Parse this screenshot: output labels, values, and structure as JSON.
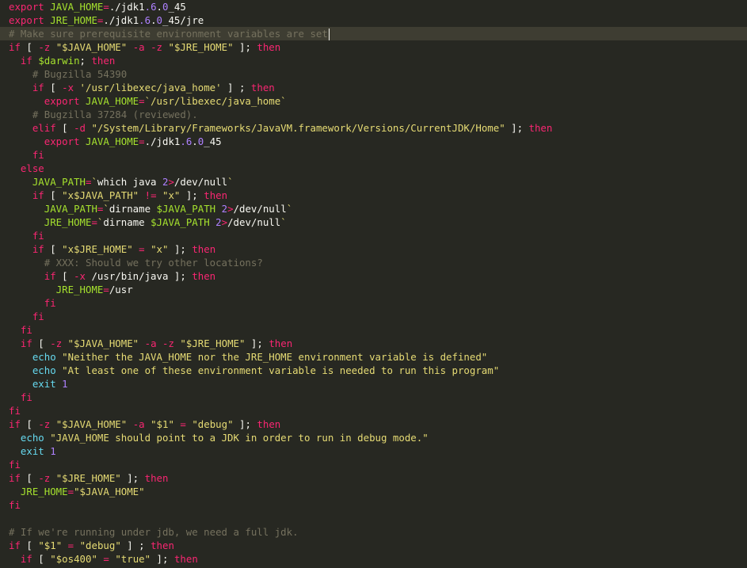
{
  "colors": {
    "background": "#272822",
    "current_line": "#3e3d32",
    "keyword": "#f92672",
    "builtin": "#66d9ef",
    "string": "#e6db74",
    "number": "#ae81ff",
    "variable": "#a6e22e",
    "comment": "#75715e",
    "text": "#f8f8f2"
  },
  "editor": {
    "current_line_index": 2,
    "lines": [
      [
        [
          "kw",
          "export"
        ],
        [
          "tx",
          " "
        ],
        [
          "var",
          "JAVA_HOME"
        ],
        [
          "kw",
          "="
        ],
        [
          "tx",
          "./jdk1"
        ],
        [
          "num",
          ".6"
        ],
        [
          "tx",
          "."
        ],
        [
          "num",
          "0"
        ],
        [
          "tx",
          "_45"
        ]
      ],
      [
        [
          "kw",
          "export"
        ],
        [
          "tx",
          " "
        ],
        [
          "var",
          "JRE_HOME"
        ],
        [
          "kw",
          "="
        ],
        [
          "tx",
          "./jdk1"
        ],
        [
          "num",
          ".6"
        ],
        [
          "tx",
          "."
        ],
        [
          "num",
          "0"
        ],
        [
          "tx",
          "_45/jre"
        ]
      ],
      [
        [
          "cm",
          "# Make sure prerequisite environment variables are set"
        ]
      ],
      [
        [
          "kw",
          "if"
        ],
        [
          "tx",
          " [ "
        ],
        [
          "kw",
          "-z"
        ],
        [
          "tx",
          " "
        ],
        [
          "str",
          "\"$JAVA_HOME\""
        ],
        [
          "tx",
          " "
        ],
        [
          "kw",
          "-a"
        ],
        [
          "tx",
          " "
        ],
        [
          "kw",
          "-z"
        ],
        [
          "tx",
          " "
        ],
        [
          "str",
          "\"$JRE_HOME\""
        ],
        [
          "tx",
          " ]; "
        ],
        [
          "kw",
          "then"
        ]
      ],
      [
        [
          "tx",
          "  "
        ],
        [
          "kw",
          "if"
        ],
        [
          "tx",
          " "
        ],
        [
          "var",
          "$darwin"
        ],
        [
          "tx",
          "; "
        ],
        [
          "kw",
          "then"
        ]
      ],
      [
        [
          "tx",
          "    "
        ],
        [
          "cm",
          "# Bugzilla 54390"
        ]
      ],
      [
        [
          "tx",
          "    "
        ],
        [
          "kw",
          "if"
        ],
        [
          "tx",
          " [ "
        ],
        [
          "kw",
          "-x"
        ],
        [
          "tx",
          " "
        ],
        [
          "str",
          "'/usr/libexec/java_home'"
        ],
        [
          "tx",
          " ] ; "
        ],
        [
          "kw",
          "then"
        ]
      ],
      [
        [
          "tx",
          "      "
        ],
        [
          "kw",
          "export"
        ],
        [
          "tx",
          " "
        ],
        [
          "var",
          "JAVA_HOME"
        ],
        [
          "kw",
          "="
        ],
        [
          "str",
          "`/usr/libexec/java_home`"
        ]
      ],
      [
        [
          "tx",
          "    "
        ],
        [
          "cm",
          "# Bugzilla 37284 (reviewed)."
        ]
      ],
      [
        [
          "tx",
          "    "
        ],
        [
          "kw",
          "elif"
        ],
        [
          "tx",
          " [ "
        ],
        [
          "kw",
          "-d"
        ],
        [
          "tx",
          " "
        ],
        [
          "str",
          "\"/System/Library/Frameworks/JavaVM.framework/Versions/CurrentJDK/Home\""
        ],
        [
          "tx",
          " ]; "
        ],
        [
          "kw",
          "then"
        ]
      ],
      [
        [
          "tx",
          "      "
        ],
        [
          "kw",
          "export"
        ],
        [
          "tx",
          " "
        ],
        [
          "var",
          "JAVA_HOME"
        ],
        [
          "kw",
          "="
        ],
        [
          "tx",
          "./jdk1"
        ],
        [
          "num",
          ".6"
        ],
        [
          "tx",
          "."
        ],
        [
          "num",
          "0"
        ],
        [
          "tx",
          "_45"
        ]
      ],
      [
        [
          "tx",
          "    "
        ],
        [
          "kw",
          "fi"
        ]
      ],
      [
        [
          "tx",
          "  "
        ],
        [
          "kw",
          "else"
        ]
      ],
      [
        [
          "tx",
          "    "
        ],
        [
          "var",
          "JAVA_PATH"
        ],
        [
          "kw",
          "="
        ],
        [
          "str",
          "`"
        ],
        [
          "tx",
          "which java "
        ],
        [
          "num",
          "2"
        ],
        [
          "kw",
          ">"
        ],
        [
          "tx",
          "/dev/null"
        ],
        [
          "str",
          "`"
        ]
      ],
      [
        [
          "tx",
          "    "
        ],
        [
          "kw",
          "if"
        ],
        [
          "tx",
          " [ "
        ],
        [
          "str",
          "\"x$JAVA_PATH\""
        ],
        [
          "tx",
          " "
        ],
        [
          "kw",
          "!="
        ],
        [
          "tx",
          " "
        ],
        [
          "str",
          "\"x\""
        ],
        [
          "tx",
          " ]; "
        ],
        [
          "kw",
          "then"
        ]
      ],
      [
        [
          "tx",
          "      "
        ],
        [
          "var",
          "JAVA_PATH"
        ],
        [
          "kw",
          "="
        ],
        [
          "str",
          "`"
        ],
        [
          "tx",
          "dirname "
        ],
        [
          "var",
          "$JAVA_PATH"
        ],
        [
          "tx",
          " "
        ],
        [
          "num",
          "2"
        ],
        [
          "kw",
          ">"
        ],
        [
          "tx",
          "/dev/null"
        ],
        [
          "str",
          "`"
        ]
      ],
      [
        [
          "tx",
          "      "
        ],
        [
          "var",
          "JRE_HOME"
        ],
        [
          "kw",
          "="
        ],
        [
          "str",
          "`"
        ],
        [
          "tx",
          "dirname "
        ],
        [
          "var",
          "$JAVA_PATH"
        ],
        [
          "tx",
          " "
        ],
        [
          "num",
          "2"
        ],
        [
          "kw",
          ">"
        ],
        [
          "tx",
          "/dev/null"
        ],
        [
          "str",
          "`"
        ]
      ],
      [
        [
          "tx",
          "    "
        ],
        [
          "kw",
          "fi"
        ]
      ],
      [
        [
          "tx",
          "    "
        ],
        [
          "kw",
          "if"
        ],
        [
          "tx",
          " [ "
        ],
        [
          "str",
          "\"x$JRE_HOME\""
        ],
        [
          "tx",
          " "
        ],
        [
          "kw",
          "="
        ],
        [
          "tx",
          " "
        ],
        [
          "str",
          "\"x\""
        ],
        [
          "tx",
          " ]; "
        ],
        [
          "kw",
          "then"
        ]
      ],
      [
        [
          "tx",
          "      "
        ],
        [
          "cm",
          "# XXX: Should we try other locations?"
        ]
      ],
      [
        [
          "tx",
          "      "
        ],
        [
          "kw",
          "if"
        ],
        [
          "tx",
          " [ "
        ],
        [
          "kw",
          "-x"
        ],
        [
          "tx",
          " /usr/bin/java ]; "
        ],
        [
          "kw",
          "then"
        ]
      ],
      [
        [
          "tx",
          "        "
        ],
        [
          "var",
          "JRE_HOME"
        ],
        [
          "kw",
          "="
        ],
        [
          "tx",
          "/usr"
        ]
      ],
      [
        [
          "tx",
          "      "
        ],
        [
          "kw",
          "fi"
        ]
      ],
      [
        [
          "tx",
          "    "
        ],
        [
          "kw",
          "fi"
        ]
      ],
      [
        [
          "tx",
          "  "
        ],
        [
          "kw",
          "fi"
        ]
      ],
      [
        [
          "tx",
          "  "
        ],
        [
          "kw",
          "if"
        ],
        [
          "tx",
          " [ "
        ],
        [
          "kw",
          "-z"
        ],
        [
          "tx",
          " "
        ],
        [
          "str",
          "\"$JAVA_HOME\""
        ],
        [
          "tx",
          " "
        ],
        [
          "kw",
          "-a"
        ],
        [
          "tx",
          " "
        ],
        [
          "kw",
          "-z"
        ],
        [
          "tx",
          " "
        ],
        [
          "str",
          "\"$JRE_HOME\""
        ],
        [
          "tx",
          " ]; "
        ],
        [
          "kw",
          "then"
        ]
      ],
      [
        [
          "tx",
          "    "
        ],
        [
          "bi",
          "echo"
        ],
        [
          "tx",
          " "
        ],
        [
          "str",
          "\"Neither the JAVA_HOME nor the JRE_HOME environment variable is defined\""
        ]
      ],
      [
        [
          "tx",
          "    "
        ],
        [
          "bi",
          "echo"
        ],
        [
          "tx",
          " "
        ],
        [
          "str",
          "\"At least one of these environment variable is needed to run this program\""
        ]
      ],
      [
        [
          "tx",
          "    "
        ],
        [
          "bi",
          "exit"
        ],
        [
          "tx",
          " "
        ],
        [
          "num",
          "1"
        ]
      ],
      [
        [
          "tx",
          "  "
        ],
        [
          "kw",
          "fi"
        ]
      ],
      [
        [
          "kw",
          "fi"
        ]
      ],
      [
        [
          "kw",
          "if"
        ],
        [
          "tx",
          " [ "
        ],
        [
          "kw",
          "-z"
        ],
        [
          "tx",
          " "
        ],
        [
          "str",
          "\"$JAVA_HOME\""
        ],
        [
          "tx",
          " "
        ],
        [
          "kw",
          "-a"
        ],
        [
          "tx",
          " "
        ],
        [
          "str",
          "\"$1\""
        ],
        [
          "tx",
          " "
        ],
        [
          "kw",
          "="
        ],
        [
          "tx",
          " "
        ],
        [
          "str",
          "\"debug\""
        ],
        [
          "tx",
          " ]; "
        ],
        [
          "kw",
          "then"
        ]
      ],
      [
        [
          "tx",
          "  "
        ],
        [
          "bi",
          "echo"
        ],
        [
          "tx",
          " "
        ],
        [
          "str",
          "\"JAVA_HOME should point to a JDK in order to run in debug mode.\""
        ]
      ],
      [
        [
          "tx",
          "  "
        ],
        [
          "bi",
          "exit"
        ],
        [
          "tx",
          " "
        ],
        [
          "num",
          "1"
        ]
      ],
      [
        [
          "kw",
          "fi"
        ]
      ],
      [
        [
          "kw",
          "if"
        ],
        [
          "tx",
          " [ "
        ],
        [
          "kw",
          "-z"
        ],
        [
          "tx",
          " "
        ],
        [
          "str",
          "\"$JRE_HOME\""
        ],
        [
          "tx",
          " ]; "
        ],
        [
          "kw",
          "then"
        ]
      ],
      [
        [
          "tx",
          "  "
        ],
        [
          "var",
          "JRE_HOME"
        ],
        [
          "kw",
          "="
        ],
        [
          "str",
          "\"$JAVA_HOME\""
        ]
      ],
      [
        [
          "kw",
          "fi"
        ]
      ],
      [],
      [
        [
          "cm",
          "# If we're running under jdb, we need a full jdk."
        ]
      ],
      [
        [
          "kw",
          "if"
        ],
        [
          "tx",
          " [ "
        ],
        [
          "str",
          "\"$1\""
        ],
        [
          "tx",
          " "
        ],
        [
          "kw",
          "="
        ],
        [
          "tx",
          " "
        ],
        [
          "str",
          "\"debug\""
        ],
        [
          "tx",
          " ] ; "
        ],
        [
          "kw",
          "then"
        ]
      ],
      [
        [
          "tx",
          "  "
        ],
        [
          "kw",
          "if"
        ],
        [
          "tx",
          " [ "
        ],
        [
          "str",
          "\"$os400\""
        ],
        [
          "tx",
          " "
        ],
        [
          "kw",
          "="
        ],
        [
          "tx",
          " "
        ],
        [
          "str",
          "\"true\""
        ],
        [
          "tx",
          " ]; "
        ],
        [
          "kw",
          "then"
        ]
      ]
    ]
  }
}
